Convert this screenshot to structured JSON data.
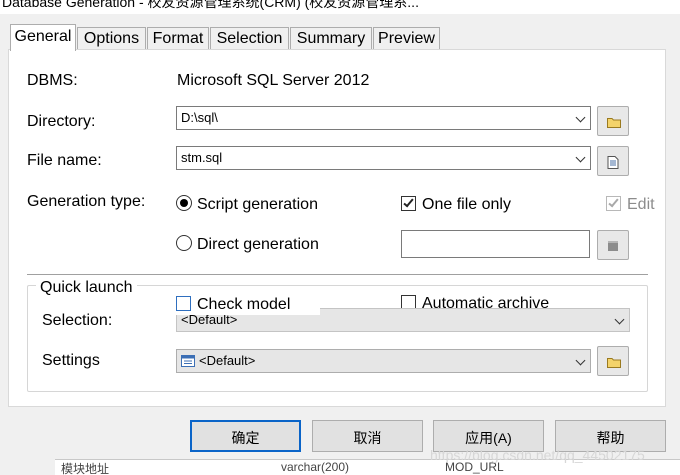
{
  "window": {
    "title": "Database Generation - 校友资源管理系统(CRM) (校友资源管理系..."
  },
  "tabs": [
    "General",
    "Options",
    "Format",
    "Selection",
    "Summary",
    "Preview"
  ],
  "general": {
    "dbms_label": "DBMS:",
    "dbms_value": "Microsoft SQL Server 2012",
    "directory_label": "Directory:",
    "directory_value": "D:\\sql\\",
    "filename_label": "File name:",
    "filename_value": "stm.sql",
    "gentype_label": "Generation type:",
    "script_generation": "Script generation",
    "direct_generation": "Direct generation",
    "one_file_only": "One file only",
    "edit": "Edit",
    "check_model": "Check model",
    "automatic_archive": "Automatic archive"
  },
  "quick_launch": {
    "title": "Quick launch",
    "selection_label": "Selection:",
    "selection_value": "<Default>",
    "settings_label": "Settings",
    "settings_value": "<Default>"
  },
  "buttons": {
    "ok": "确定",
    "cancel": "取消",
    "apply": "应用(A)",
    "help": "帮助"
  },
  "background": {
    "col1": "模块地址",
    "col2": "varchar(200)",
    "col3": "MOD_URL"
  },
  "watermark": "https://blog.csdn.net/qq_44502175"
}
